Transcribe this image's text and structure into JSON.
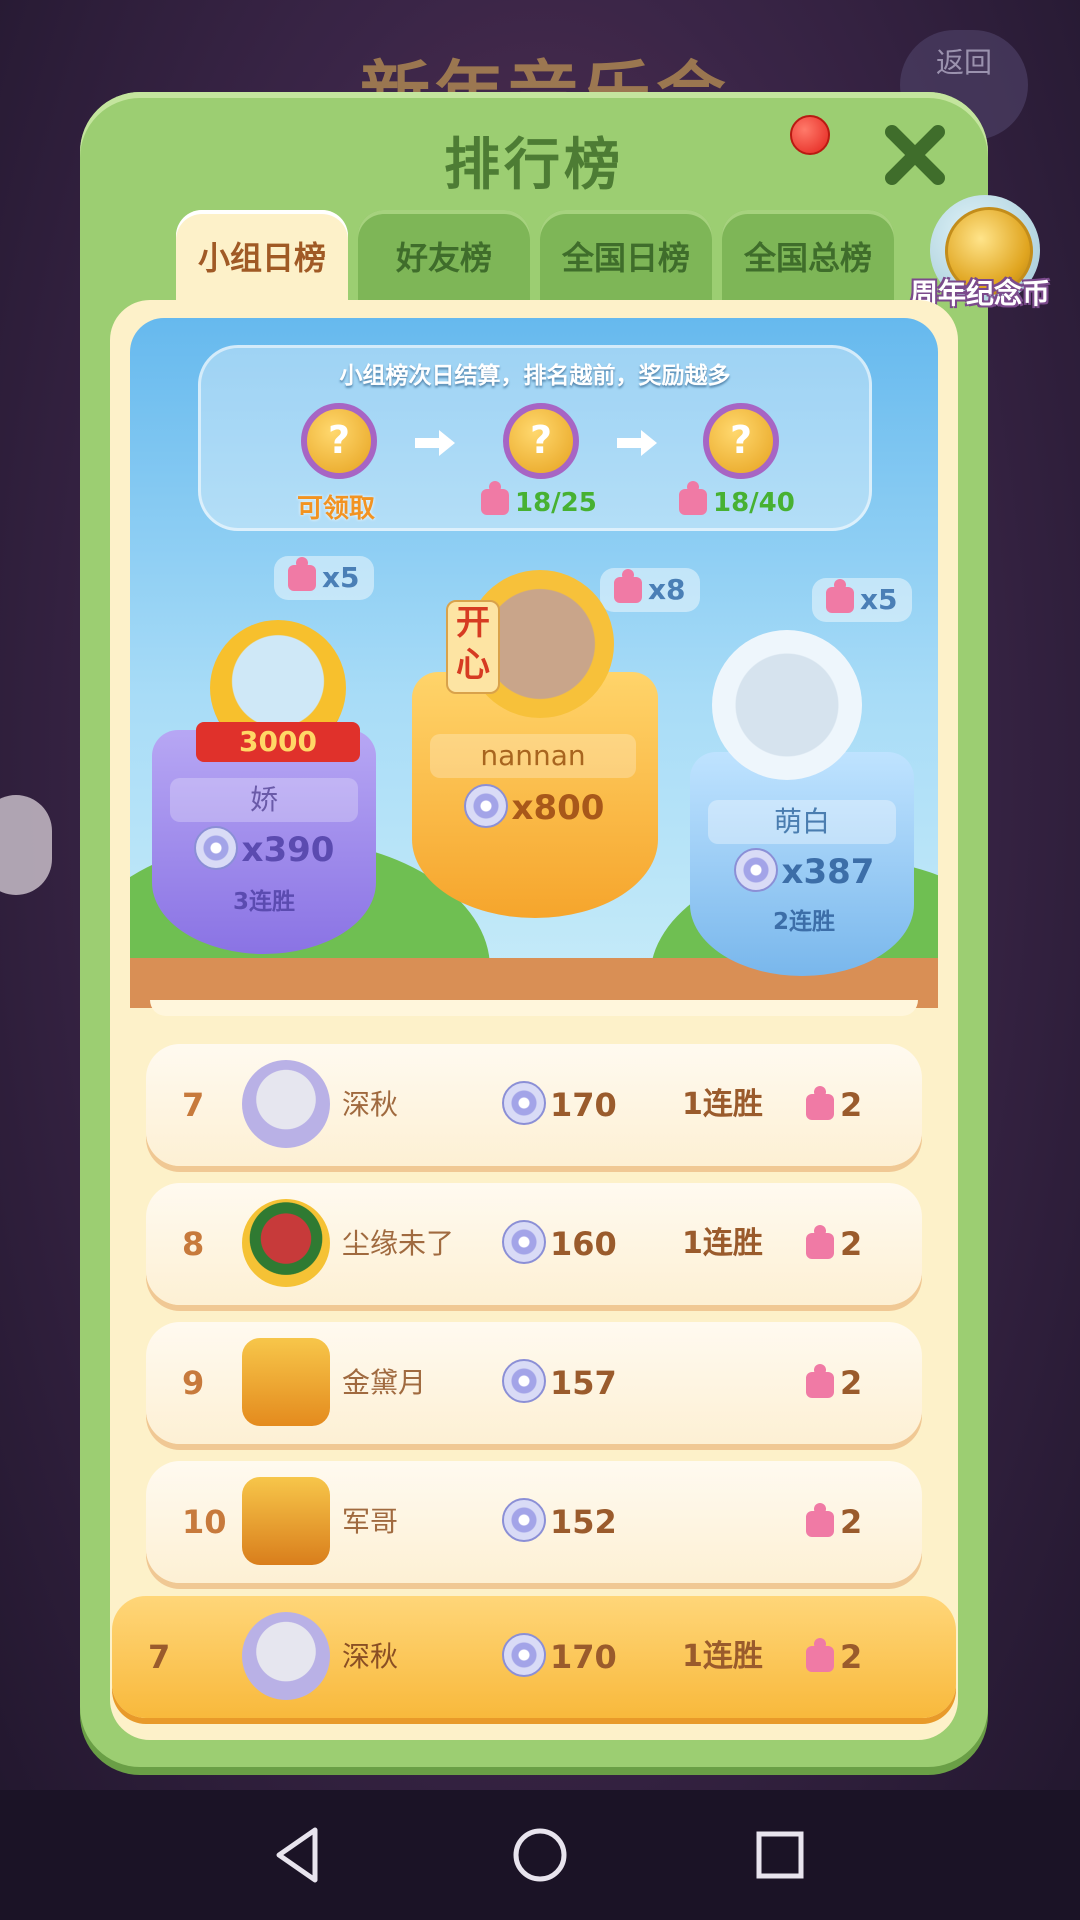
{
  "background": {
    "title": "新年音乐会",
    "back_label": "返回"
  },
  "panel": {
    "title": "排行榜",
    "tabs": [
      "小组日榜",
      "好友榜",
      "全国日榜",
      "全国总榜"
    ],
    "coin_badge_label": "周年纪念币"
  },
  "rewards": {
    "tip": "小组榜次日结算，排名越前，奖励越多",
    "claim_label": "可领取",
    "progress1": "18/25",
    "progress2": "18/40"
  },
  "podium": {
    "left": {
      "bubble": "x5",
      "banner": "3000",
      "name": "娇",
      "score": "x390",
      "streak": "3连胜"
    },
    "mid": {
      "bubble": "x8",
      "tag": "开心",
      "name": "nannan",
      "score": "x800"
    },
    "right": {
      "bubble": "x5",
      "name": "萌白",
      "score": "x387",
      "streak": "2连胜"
    }
  },
  "rows": [
    {
      "rank": "7",
      "name": "深秋",
      "score": "170",
      "streak": "1连胜",
      "pieces": "2"
    },
    {
      "rank": "8",
      "name": "尘缘未了",
      "score": "160",
      "streak": "1连胜",
      "pieces": "2"
    },
    {
      "rank": "9",
      "name": "金黛月",
      "score": "157",
      "streak": "",
      "pieces": "2"
    },
    {
      "rank": "10",
      "name": "军哥",
      "score": "152",
      "streak": "",
      "pieces": "2"
    }
  ],
  "me": {
    "rank": "7",
    "name": "深秋",
    "score": "170",
    "streak": "1连胜",
    "pieces": "2"
  },
  "icons": {
    "close": "close-icon",
    "coin": "coin-icon",
    "disc": "disc-icon",
    "puzzle": "puzzle-piece-icon"
  },
  "colors": {
    "panel_green": "#9cce72",
    "tab_active": "#fdf1c9",
    "me_row": "#f8b93c"
  }
}
